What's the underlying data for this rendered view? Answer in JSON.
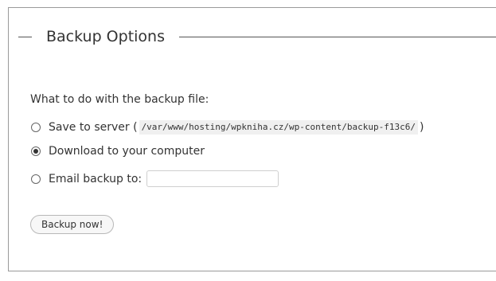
{
  "section": {
    "title": "Backup Options"
  },
  "question": "What to do with the backup file:",
  "options": [
    {
      "label": "Save to server (",
      "path": "/var/www/hosting/wpkniha.cz/wp-content/backup-f13c6/",
      "label_suffix": ")",
      "selected": false
    },
    {
      "label": "Download to your computer",
      "selected": true
    },
    {
      "label": "Email backup to:",
      "input_value": "",
      "selected": false
    }
  ],
  "button": {
    "label": "Backup now!"
  }
}
